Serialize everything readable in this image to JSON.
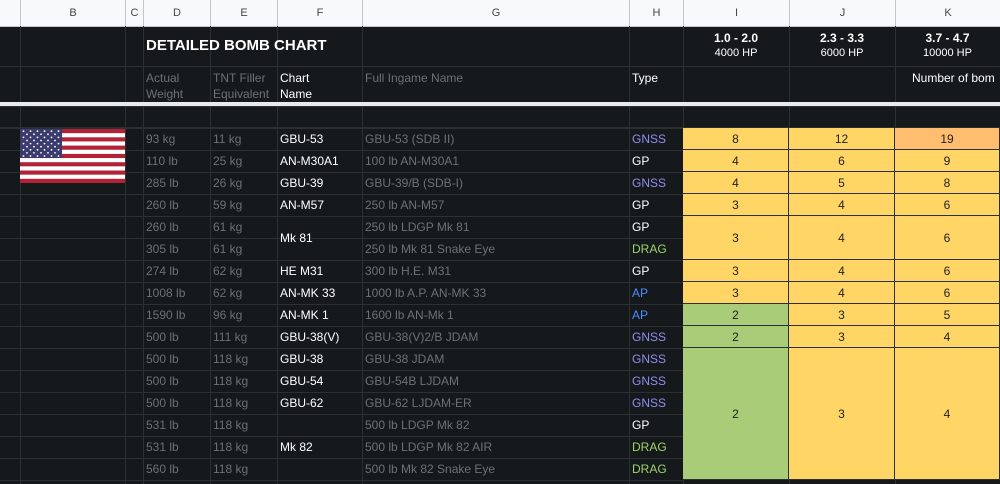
{
  "columns": [
    "",
    "B",
    "C",
    "D",
    "E",
    "F",
    "G",
    "H",
    "I",
    "J",
    "K"
  ],
  "title": "DETAILED BOMB CHART",
  "tiers": [
    {
      "range": "1.0 - 2.0",
      "hp": "4000 HP"
    },
    {
      "range": "2.3 - 3.3",
      "hp": "6000 HP"
    },
    {
      "range": "3.7 - 4.7",
      "hp": "10000 HP"
    }
  ],
  "headers": {
    "actual_weight": [
      "Actual",
      "Weight"
    ],
    "tnt": [
      "TNT Filler",
      "Equivalent"
    ],
    "chart_name": [
      "Chart",
      "Name"
    ],
    "full_name": "Full Ingame Name",
    "type": "Type",
    "number_of_bombs": "Number of bom"
  },
  "country": "United States",
  "type_colors": {
    "GNSS": "#8e8ef0",
    "GP": "#ffffff",
    "DRAG": "#9ed36a",
    "AP": "#4c8cff"
  },
  "value_colors": {
    "yellow": "#ffd666",
    "orange": "#ffbe6f",
    "green": "#a8cc78"
  },
  "rows": [
    {
      "weight": "93 kg",
      "tnt": "11 kg",
      "chart_name": "GBU-53",
      "full_name": "GBU-53 (SDB II)",
      "type": "GNSS"
    },
    {
      "weight": "110 lb",
      "tnt": "25 kg",
      "chart_name": "AN-M30A1",
      "full_name": "100 lb AN-M30A1",
      "type": "GP"
    },
    {
      "weight": "285 lb",
      "tnt": "26 kg",
      "chart_name": "GBU-39",
      "full_name": "GBU-39/B (SDB-I)",
      "type": "GNSS"
    },
    {
      "weight": "260 lb",
      "tnt": "59 kg",
      "chart_name": "AN-M57",
      "full_name": "250 lb AN-M57",
      "type": "GP"
    },
    {
      "weight": "260 lb",
      "tnt": "61 kg",
      "chart_name": "",
      "full_name": "250 lb LDGP Mk 81",
      "type": "GP"
    },
    {
      "weight": "305 lb",
      "tnt": "61 kg",
      "chart_name": "",
      "full_name": "250 lb Mk 81 Snake Eye",
      "type": "DRAG"
    },
    {
      "weight": "274 lb",
      "tnt": "62 kg",
      "chart_name": "HE M31",
      "full_name": "300 lb H.E. M31",
      "type": "GP"
    },
    {
      "weight": "1008 lb",
      "tnt": "62 kg",
      "chart_name": "AN-MK 33",
      "full_name": "1000 lb A.P. AN-MK 33",
      "type": "AP"
    },
    {
      "weight": "1590 lb",
      "tnt": "96 kg",
      "chart_name": "AN-MK 1",
      "full_name": "1600 lb AN-Mk 1",
      "type": "AP"
    },
    {
      "weight": "500 lb",
      "tnt": "111 kg",
      "chart_name": "GBU-38(V)",
      "full_name": "GBU-38(V)2/B JDAM",
      "type": "GNSS"
    },
    {
      "weight": "500 lb",
      "tnt": "118 kg",
      "chart_name": "GBU-38",
      "full_name": "GBU-38 JDAM",
      "type": "GNSS"
    },
    {
      "weight": "500 lb",
      "tnt": "118 kg",
      "chart_name": "GBU-54",
      "full_name": "GBU-54B LJDAM",
      "type": "GNSS"
    },
    {
      "weight": "500 lb",
      "tnt": "118 kg",
      "chart_name": "GBU-62",
      "full_name": "GBU-62 LJDAM-ER",
      "type": "GNSS"
    },
    {
      "weight": "531 lb",
      "tnt": "118 kg",
      "chart_name": "",
      "full_name": "500 lb LDGP Mk 82",
      "type": "GP"
    },
    {
      "weight": "531 lb",
      "tnt": "118 kg",
      "chart_name": "",
      "full_name": "500 lb LDGP Mk 82 AIR",
      "type": "DRAG"
    },
    {
      "weight": "560 lb",
      "tnt": "118 kg",
      "chart_name": "",
      "full_name": "500 lb Mk 82 Snake Eye",
      "type": "DRAG"
    }
  ],
  "merged_names": [
    {
      "label": "Mk 81",
      "start": 4,
      "span": 2
    },
    {
      "label": "Mk 82",
      "start": 13,
      "span": 3
    }
  ],
  "value_groups": [
    {
      "start": 0,
      "span": 1,
      "values": [
        "8",
        "12",
        "19"
      ],
      "colors": [
        "yellow",
        "yellow",
        "orange"
      ]
    },
    {
      "start": 1,
      "span": 1,
      "values": [
        "4",
        "6",
        "9"
      ],
      "colors": [
        "yellow",
        "yellow",
        "yellow"
      ]
    },
    {
      "start": 2,
      "span": 1,
      "values": [
        "4",
        "5",
        "8"
      ],
      "colors": [
        "yellow",
        "yellow",
        "yellow"
      ]
    },
    {
      "start": 3,
      "span": 1,
      "values": [
        "3",
        "4",
        "6"
      ],
      "colors": [
        "yellow",
        "yellow",
        "yellow"
      ]
    },
    {
      "start": 4,
      "span": 2,
      "values": [
        "3",
        "4",
        "6"
      ],
      "colors": [
        "yellow",
        "yellow",
        "yellow"
      ]
    },
    {
      "start": 6,
      "span": 1,
      "values": [
        "3",
        "4",
        "6"
      ],
      "colors": [
        "yellow",
        "yellow",
        "yellow"
      ]
    },
    {
      "start": 7,
      "span": 1,
      "values": [
        "3",
        "4",
        "6"
      ],
      "colors": [
        "yellow",
        "yellow",
        "yellow"
      ]
    },
    {
      "start": 8,
      "span": 1,
      "values": [
        "2",
        "3",
        "5"
      ],
      "colors": [
        "green",
        "yellow",
        "yellow"
      ]
    },
    {
      "start": 9,
      "span": 1,
      "values": [
        "2",
        "3",
        "4"
      ],
      "colors": [
        "green",
        "yellow",
        "yellow"
      ]
    },
    {
      "start": 10,
      "span": 6,
      "values": [
        "2",
        "3",
        "4"
      ],
      "colors": [
        "green",
        "yellow",
        "yellow"
      ]
    }
  ]
}
